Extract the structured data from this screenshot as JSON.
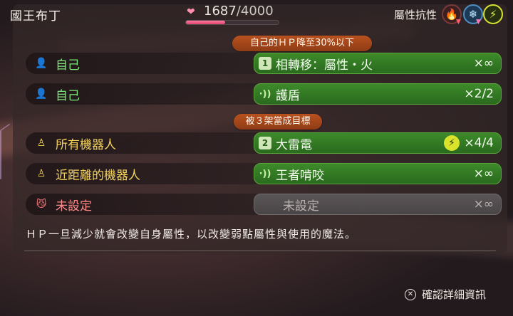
{
  "header": {
    "title": "國王布丁",
    "hp_current": "1687",
    "hp_separator": "/",
    "hp_max": "4000",
    "hp_fraction": 0.42,
    "resistance_label": "屬性抗性",
    "resistances": [
      {
        "element": "fire",
        "icon": "fire-icon",
        "modifier": "down"
      },
      {
        "element": "ice",
        "icon": "ice-icon",
        "modifier": "down"
      },
      {
        "element": "electric",
        "icon": "lightning-icon",
        "modifier": "none"
      }
    ]
  },
  "conditions": {
    "first": "自己的ＨＰ降至30%以下",
    "second": "被３架當成目標"
  },
  "rows": [
    {
      "target": "自己",
      "target_type": "self",
      "action_icon": "1",
      "action": "相轉移：屬性・火",
      "count": "×∞"
    },
    {
      "target": "自己",
      "target_type": "self",
      "action_icon": "wave",
      "action": "護盾",
      "count": "×2/2"
    },
    {
      "target": "所有機器人",
      "target_type": "robot",
      "action_icon": "2",
      "action": "大雷電",
      "element_icon": "lightning-icon",
      "count": "×4/4"
    },
    {
      "target": "近距離的機器人",
      "target_type": "robot",
      "action_icon": "wave",
      "action": "王者啃咬",
      "count": "×∞"
    },
    {
      "target": "未設定",
      "target_type": "none",
      "action_icon": "",
      "action": "未設定",
      "count": "×∞"
    }
  ],
  "description": "ＨＰ一旦減少就會改變自身屬性，以改變弱點屬性與使用的魔法。",
  "footer": {
    "button_glyph": "✕",
    "label": "確認詳細資訊"
  },
  "colors": {
    "self": "#7fe87a",
    "robot": "#f5d45a",
    "unset": "#ff8a8a",
    "action_green": "#3d8a2a",
    "condition_orange": "#b8521f",
    "hp_pink": "#e0456d"
  }
}
